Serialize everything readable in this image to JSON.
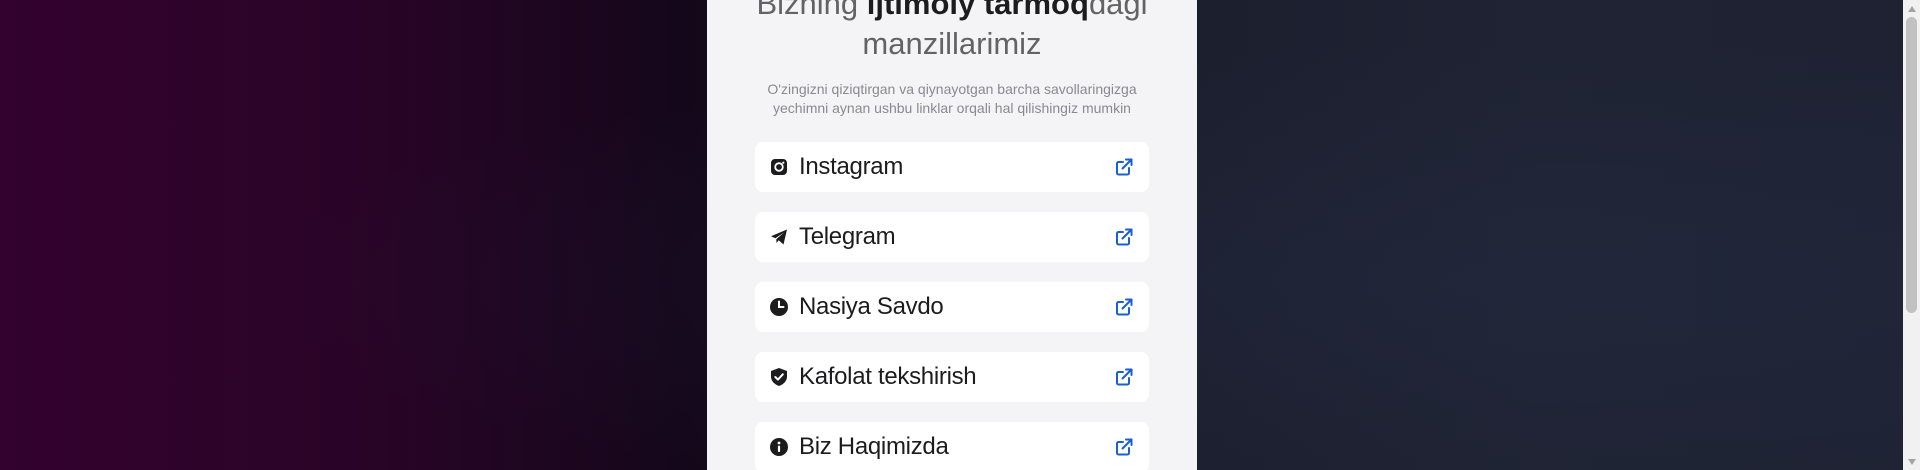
{
  "heading": {
    "part1": "Bizning ",
    "part2_bold": "ijtimoiy tarmoq",
    "part3": "dagi",
    "line2": "manzillarimiz"
  },
  "subtitle": "O'zingizni qiziqtirgan va qiynayotgan barcha savollaringizga yechimni aynan ushbu linklar orqali hal qilishingiz mumkin",
  "links": [
    {
      "label": "Instagram",
      "icon": "instagram-icon"
    },
    {
      "label": "Telegram",
      "icon": "telegram-icon"
    },
    {
      "label": "Nasiya Savdo",
      "icon": "clock-icon"
    },
    {
      "label": "Kafolat tekshirish",
      "icon": "shield-check-icon"
    },
    {
      "label": "Biz Haqimizda",
      "icon": "info-icon"
    }
  ],
  "colors": {
    "panel_bg": "#f4f4f6",
    "card_bg": "#ffffff",
    "text_dark": "#1c1c1e",
    "text_muted": "#8a8a8e",
    "link_accent": "#1a5fd0",
    "bg_left": "#33022e",
    "bg_right": "#1e2233"
  }
}
